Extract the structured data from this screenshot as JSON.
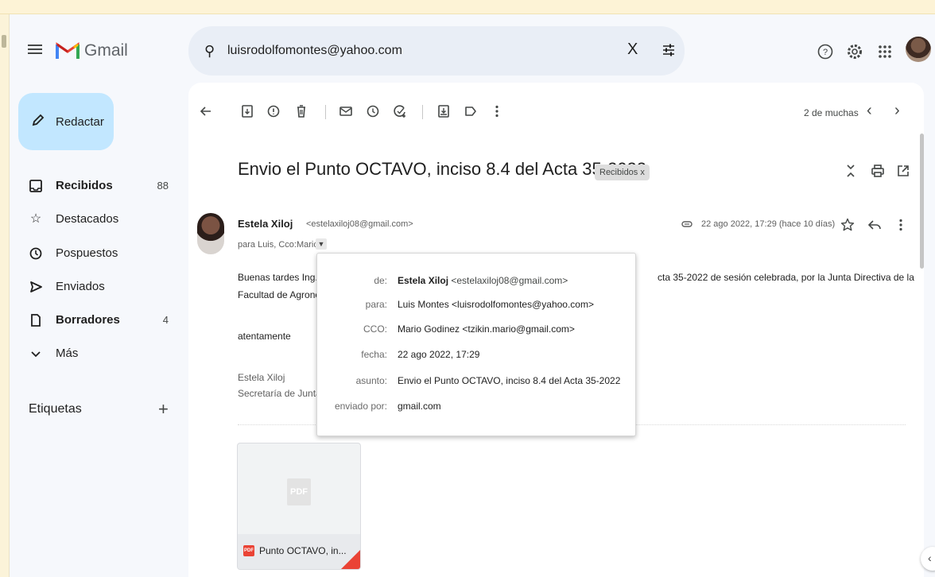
{
  "header": {
    "app_name": "Gmail",
    "search_value": "luisrodolfomontes@yahoo.com",
    "search_clear": "X"
  },
  "sidebar": {
    "compose_label": "Redactar",
    "items": [
      {
        "label": "Recibidos",
        "count": "88",
        "bold": true
      },
      {
        "label": "Destacados",
        "count": "",
        "bold": false
      },
      {
        "label": "Pospuestos",
        "count": "",
        "bold": false
      },
      {
        "label": "Enviados",
        "count": "",
        "bold": false
      },
      {
        "label": "Borradores",
        "count": "4",
        "bold": true
      },
      {
        "label": "Más",
        "count": "",
        "bold": false
      }
    ],
    "labels_title": "Etiquetas",
    "labels_add": "+"
  },
  "toolbar": {
    "pager": "2 de muchas"
  },
  "message": {
    "subject": "Envio el Punto OCTAVO, inciso 8.4 del Acta 35-2022",
    "label_chip": "Recibidos x",
    "sender_name": "Estela Xiloj",
    "sender_email": "<estelaxiloj08@gmail.com>",
    "to_line": "para Luis, Cco:Mario",
    "date": "22 ago 2022, 17:29 (hace 10 días)",
    "body": {
      "line1_left": "Buenas tardes Ing. /",
      "line1_right": "cta 35-2022 de sesión celebrada, por la Junta Directiva de la",
      "line2_left": "Facultad de Agronor",
      "closing": "atentamente",
      "sig_name": "Estela Xiloj",
      "sig_title": "Secretaría de Junta"
    },
    "attachment": {
      "badge": "PDF",
      "type_icon": "PDF",
      "name": "Punto OCTAVO, in..."
    }
  },
  "details_popup": {
    "rows": [
      {
        "key": "de:",
        "name": "Estela Xiloj",
        "email": "<estelaxiloj08@gmail.com>"
      },
      {
        "key": "para:",
        "value": "Luis Montes <luisrodolfomontes@yahoo.com>"
      },
      {
        "key": "CCO:",
        "value": "Mario Godinez <tzikin.mario@gmail.com>"
      },
      {
        "key": "fecha:",
        "value": "22 ago 2022, 17:29"
      },
      {
        "key": "asunto:",
        "value": "Envio el Punto OCTAVO, inciso 8.4 del Acta 35-2022"
      },
      {
        "key": "enviado por:",
        "value": "gmail.com"
      }
    ]
  },
  "colors": {
    "compose_bg": "#c2e7ff",
    "search_bg": "#e9eef6",
    "app_bg": "#f6f8fc",
    "gmail_red": "#ea4335"
  }
}
